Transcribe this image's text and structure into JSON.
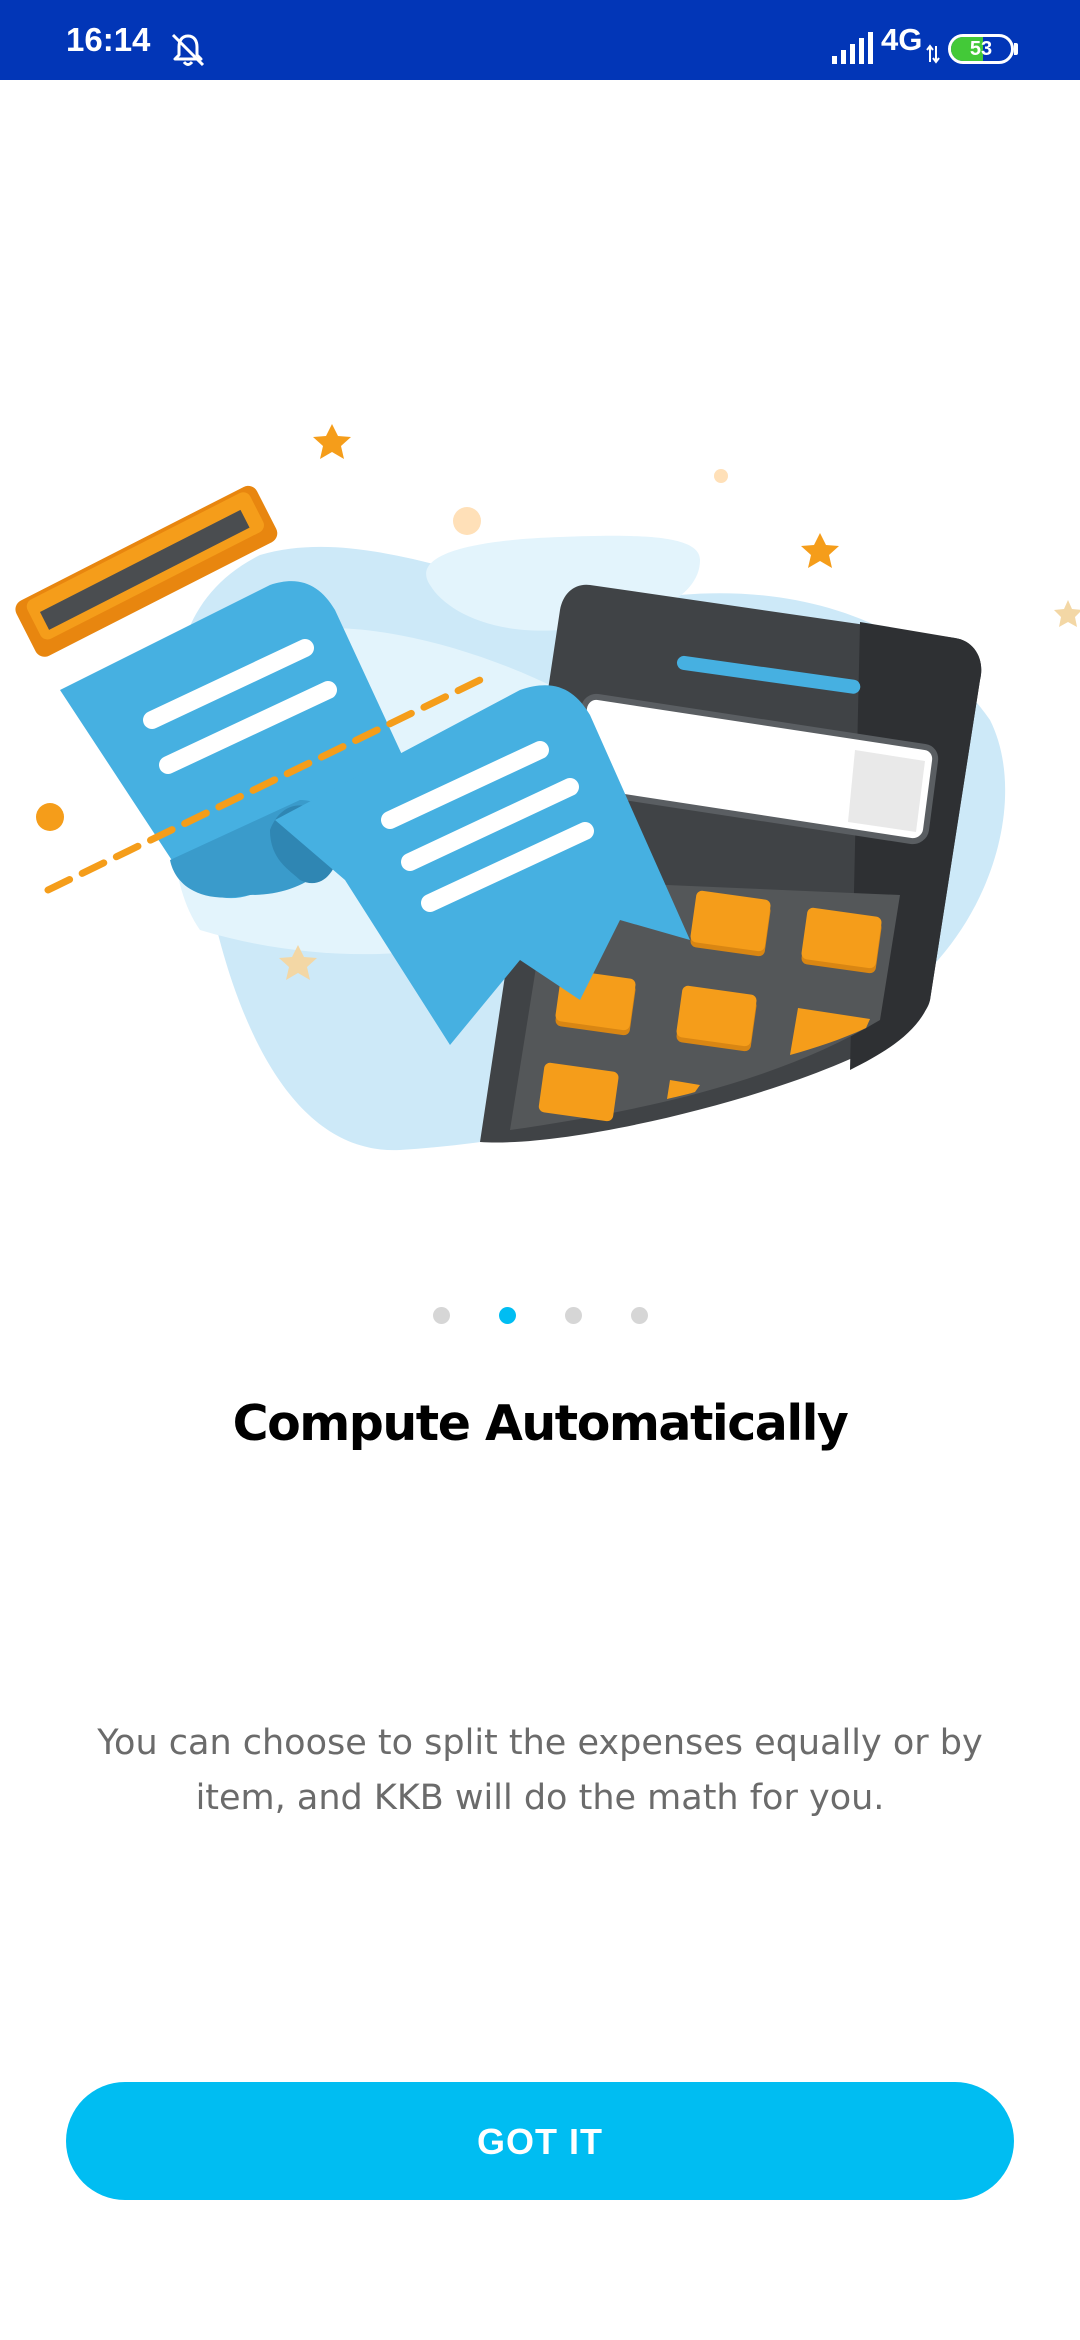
{
  "status_bar": {
    "time": "16:14",
    "network": "4G",
    "battery_level": "53",
    "battery_fraction": 0.53,
    "icons": [
      "do-not-disturb-icon",
      "signal-icon",
      "data-arrows-icon",
      "battery-icon"
    ]
  },
  "illustration": {
    "icon": "receipt-calculator-illustration"
  },
  "pager": {
    "count": 4,
    "active_index": 1
  },
  "onboarding": {
    "title": "Compute Automatically",
    "description": "You can choose to split the expenses equally or by item, and KKB will do the math for you."
  },
  "actions": {
    "got_it_label": "GOT IT"
  },
  "colors": {
    "status_bar": "#0236B7",
    "accent": "#00BDF2",
    "pager_inactive": "#D6D6D6",
    "receipt_blue": "#46B0E1",
    "orange": "#F59D1A",
    "calculator_dark": "#404346"
  }
}
